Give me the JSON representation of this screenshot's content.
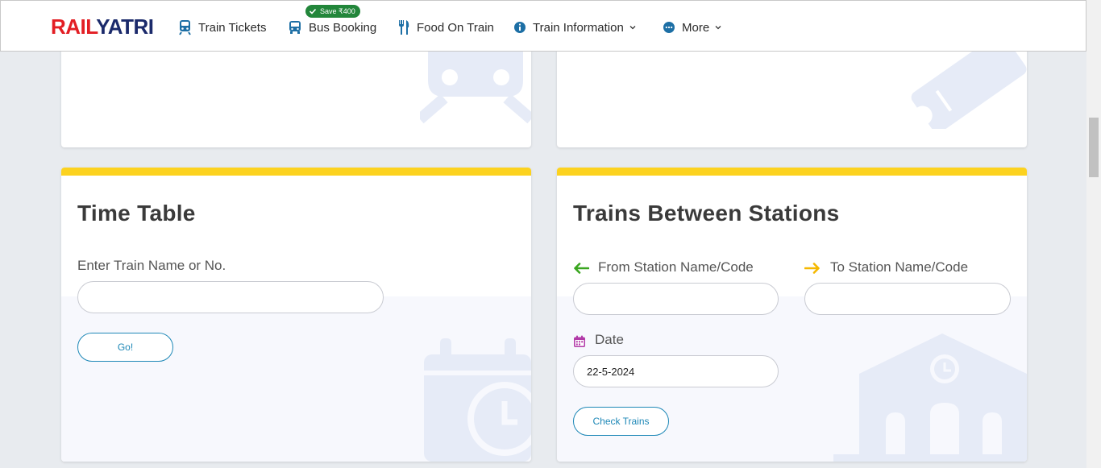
{
  "header": {
    "logo_part1": "RAIL",
    "logo_part2": "YATRI",
    "nav": [
      {
        "label": "Train Tickets",
        "icon": "train-icon"
      },
      {
        "label": "Bus Booking",
        "icon": "bus-icon"
      },
      {
        "label": "Food On Train",
        "icon": "fork-knife-icon"
      },
      {
        "label": "Train Information",
        "icon": "info-icon"
      },
      {
        "label": "More",
        "icon": "more-icon"
      }
    ],
    "save_badge": "Save ₹400"
  },
  "timetable": {
    "title": "Time Table",
    "label": "Enter Train Name or No.",
    "value": "",
    "button": "Go!"
  },
  "between": {
    "title": "Trains Between Stations",
    "from_label": "From Station Name/Code",
    "to_label": "To Station Name/Code",
    "from_value": "",
    "to_value": "",
    "date_label": "Date",
    "date_value": "22-5-2024",
    "button": "Check Trains"
  },
  "colors": {
    "accent_yellow": "#fcd21f",
    "brand_red": "#e31e24",
    "brand_blue": "#1b2a6b",
    "button_blue": "#1e88b7",
    "arrow_green": "#3aa620",
    "arrow_yellow": "#f5b800",
    "date_icon": "#b23aa8"
  }
}
